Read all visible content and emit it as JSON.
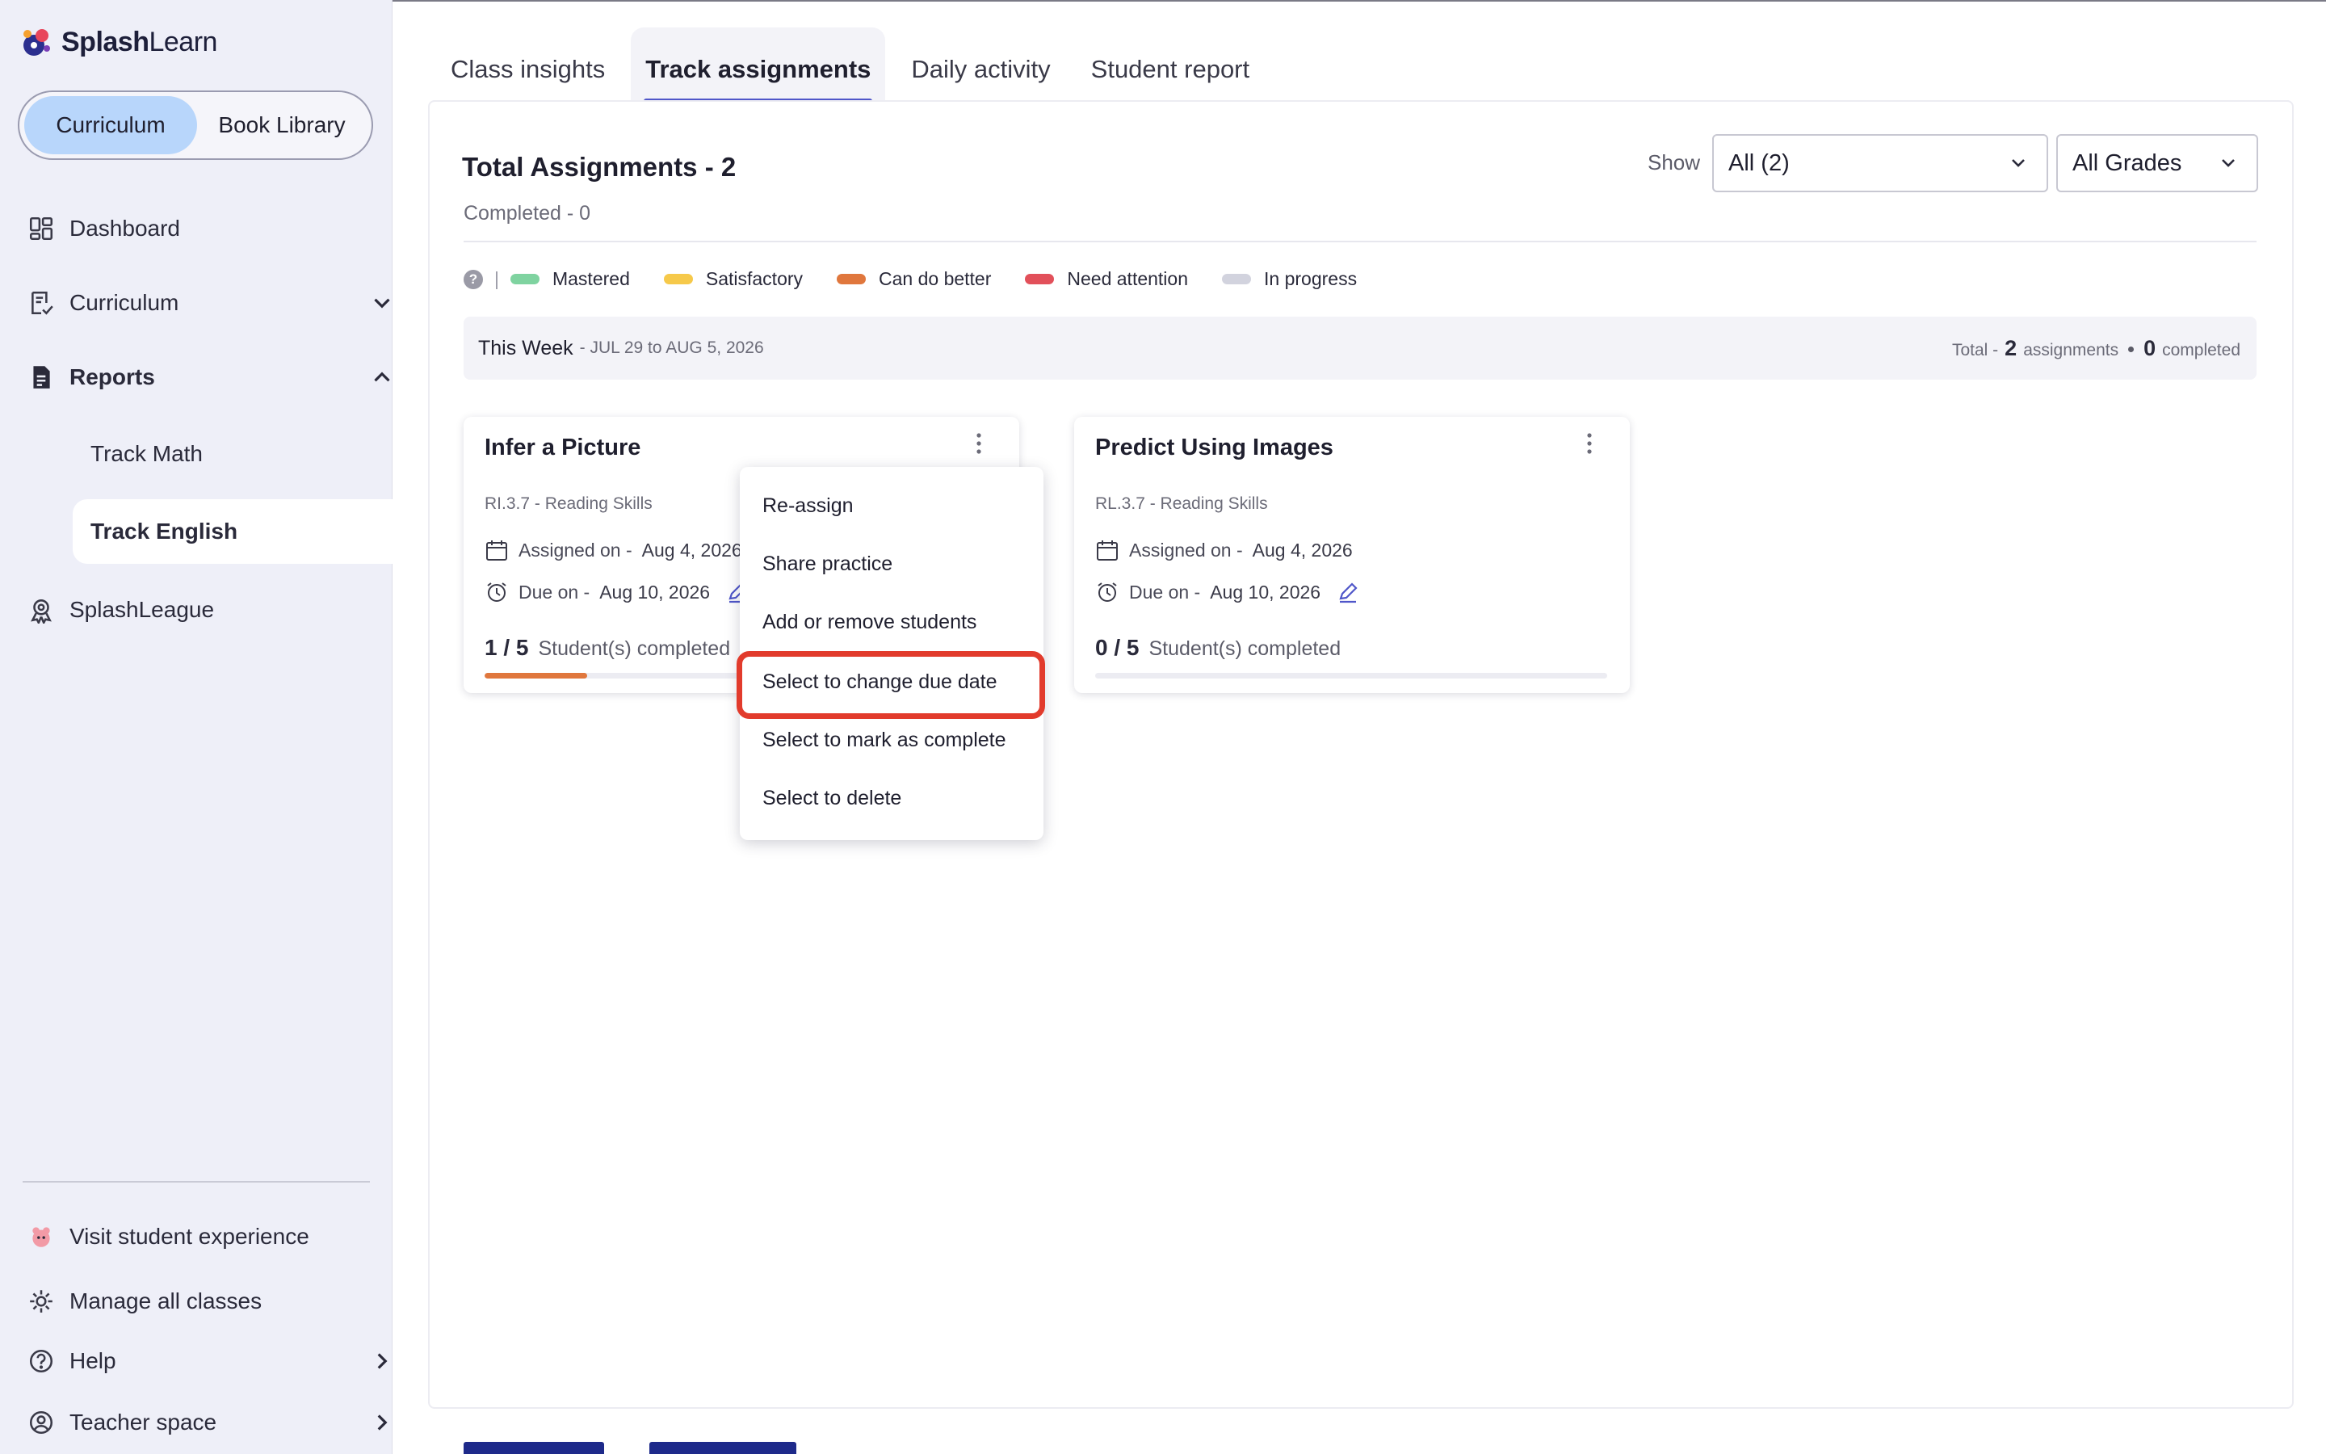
{
  "brand": {
    "name_bold": "Splash",
    "name_light": "Learn"
  },
  "library_toggle": {
    "active": "Curriculum",
    "inactive": "Book Library"
  },
  "sidebar": {
    "dashboard": "Dashboard",
    "curriculum": "Curriculum",
    "reports": "Reports",
    "track_math": "Track Math",
    "track_english": "Track English",
    "splashleague": "SplashLeague",
    "visit_student": "Visit student experience",
    "manage_classes": "Manage all classes",
    "help": "Help",
    "teacher_space": "Teacher space"
  },
  "tabs": [
    "Class insights",
    "Track assignments",
    "Daily activity",
    "Student report"
  ],
  "header": {
    "title": "Total Assignments - 2",
    "completed": "Completed - 0",
    "show_label": "Show",
    "show_value": "All (2)",
    "grade_value": "All Grades"
  },
  "legend": {
    "items": [
      {
        "label": "Mastered",
        "color": "#7fd3a0"
      },
      {
        "label": "Satisfactory",
        "color": "#f6c94a"
      },
      {
        "label": "Can do better",
        "color": "#e0773d"
      },
      {
        "label": "Need attention",
        "color": "#e2505a"
      },
      {
        "label": "In progress",
        "color": "#d2d3de"
      }
    ]
  },
  "week": {
    "title": "This Week",
    "range": "- JUL 29 to AUG 5, 2026",
    "total_prefix": "Total -",
    "total_count": "2",
    "total_suffix": "assignments",
    "completed_count": "0",
    "completed_suffix": "completed"
  },
  "cards": [
    {
      "title": "Infer a Picture",
      "skill": "RI.3.7 - Reading Skills",
      "assigned_label": "Assigned on -",
      "assigned_date": "Aug 4, 2026",
      "due_label": "Due on -",
      "due_date": "Aug 10, 2026",
      "count": "1 / 5",
      "count_label": "Student(s) completed",
      "progress": 0.2
    },
    {
      "title": "Predict Using Images",
      "skill": "RL.3.7 - Reading Skills",
      "assigned_label": "Assigned on -",
      "assigned_date": "Aug 4, 2026",
      "due_label": "Due on -",
      "due_date": "Aug 10, 2026",
      "count": "0 / 5",
      "count_label": "Student(s) completed",
      "progress": 0
    }
  ],
  "menu": {
    "items": [
      "Re-assign",
      "Share practice",
      "Add or remove students",
      "Select to change due date",
      "Select to mark as complete",
      "Select to delete"
    ],
    "highlighted": "Select to change due date"
  },
  "colors": {
    "accent": "#4f56c9",
    "sidebar_bg": "#eeeff8",
    "toggle_active": "#b8d6fb",
    "highlight": "#e23b2c",
    "progress": "#e0773d"
  }
}
